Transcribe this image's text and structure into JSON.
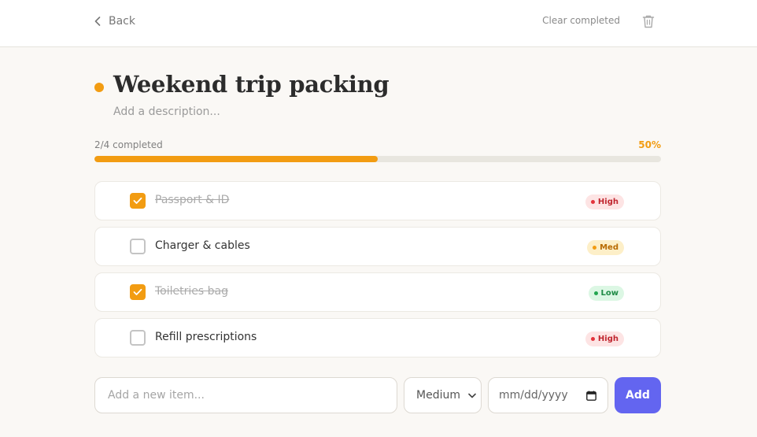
{
  "header": {
    "back_label": "Back",
    "clear_label": "Clear completed"
  },
  "list": {
    "title": "Weekend trip packing",
    "accent_color": "#f29c12",
    "description_placeholder": "Add a description..."
  },
  "progress": {
    "label": "2/4 completed",
    "percent_label": "50%",
    "completed": 2,
    "total": 4,
    "fraction": 0.5
  },
  "items": [
    {
      "text": "Passport & ID",
      "done": true,
      "priority": "High"
    },
    {
      "text": "Charger & cables",
      "done": false,
      "priority": "Med"
    },
    {
      "text": "Toiletries bag",
      "done": true,
      "priority": "Low"
    },
    {
      "text": "Refill prescriptions",
      "done": false,
      "priority": "High"
    }
  ],
  "add_form": {
    "input_placeholder": "Add a new item...",
    "priority_value": "Medium",
    "date_placeholder": "mm/dd/yyyy",
    "add_label": "Add"
  },
  "colors": {
    "accent": "#f29c12",
    "primary_button": "#6365f0",
    "high": "#e3333c",
    "med": "#f29c12",
    "low": "#22a64f"
  }
}
